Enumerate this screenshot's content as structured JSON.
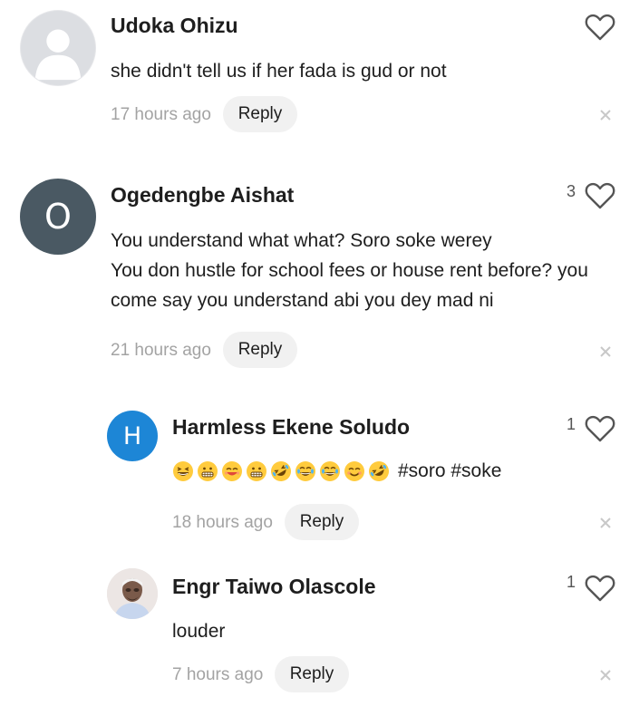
{
  "comments": [
    {
      "author": "Udoka Ohizu",
      "text": "she didn't tell us if her fada is gud or not",
      "time": "17 hours ago",
      "reply_label": "Reply",
      "likes": ""
    },
    {
      "author": "Ogedengbe Aishat",
      "avatar_letter": "O",
      "avatar_color": "#4a5963",
      "lines": [
        "You understand what what? Soro soke werey",
        "You don hustle for school fees or house rent before? you",
        "come say you understand abi you dey mad ni"
      ],
      "time": "21 hours ago",
      "reply_label": "Reply",
      "likes": "3"
    },
    {
      "author": "Harmless Ekene Soludo",
      "avatar_letter": "H",
      "avatar_color": "#1d86d6",
      "hashtags": "#soro #soke",
      "emojis": [
        "grinning-squint",
        "grimacing",
        "smiling-closed-eyes",
        "grimacing",
        "rofl",
        "tears-of-joy",
        "tears-of-joy",
        "smiling-face",
        "rofl"
      ],
      "time": "18 hours ago",
      "reply_label": "Reply",
      "likes": "1"
    },
    {
      "author": "Engr Taiwo Olascole",
      "text": "louder",
      "time": "7 hours ago",
      "reply_label": "Reply",
      "likes": "1"
    }
  ],
  "colors": {
    "text": "#1e1e1e",
    "muted": "#a3a3a3",
    "reply_bg": "#f1f1f1",
    "heart": "#555555"
  }
}
